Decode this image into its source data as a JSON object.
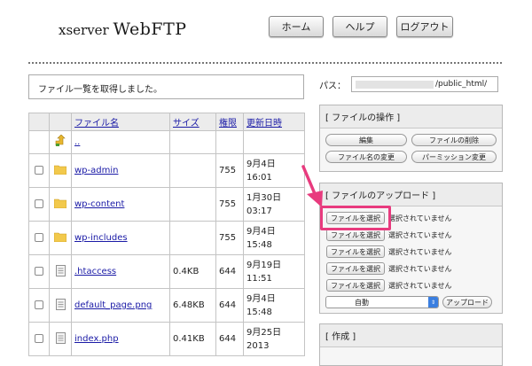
{
  "header": {
    "logo_prefix": "xserver ",
    "logo_main": "WebFTP",
    "buttons": {
      "home": "ホーム",
      "help": "ヘルプ",
      "logout": "ログアウト"
    }
  },
  "status_message": "ファイル一覧を取得しました。",
  "path": {
    "label": "パス：",
    "value": "/public_html/"
  },
  "file_table": {
    "columns": [
      "ファイル名",
      "サイズ",
      "権限",
      "更新日時"
    ],
    "parent_link": "..",
    "rows": [
      {
        "name": "wp-admin",
        "size": "",
        "perm": "755",
        "date": "9月4日",
        "time": "16:01",
        "icon": "folder-icon"
      },
      {
        "name": "wp-content",
        "size": "",
        "perm": "755",
        "date": "1月30日",
        "time": "03:17",
        "icon": "folder-icon"
      },
      {
        "name": "wp-includes",
        "size": "",
        "perm": "755",
        "date": "9月4日",
        "time": "15:48",
        "icon": "folder-icon"
      },
      {
        "name": ".htaccess",
        "size": "0.4KB",
        "perm": "644",
        "date": "9月19日",
        "time": "11:51",
        "icon": "file-icon"
      },
      {
        "name": "default_page.png",
        "size": "6.48KB",
        "perm": "644",
        "date": "9月4日",
        "time": "15:48",
        "icon": "file-icon"
      },
      {
        "name": "index.php",
        "size": "0.41KB",
        "perm": "644",
        "date": "9月25日",
        "time": "2013",
        "icon": "file-icon"
      }
    ]
  },
  "file_ops": {
    "title": "[ ファイルの操作 ]",
    "edit": "編集",
    "delete": "ファイルの削除",
    "rename": "ファイル名の変更",
    "permission": "パーミッション変更"
  },
  "upload": {
    "title": "[ ファイルのアップロード ]",
    "choose_label": "ファイルを選択",
    "no_file_label": "選択されていません",
    "mode_value": "自動",
    "upload_button": "アップロード"
  },
  "create": {
    "title": "[ 作成 ]"
  },
  "colors": {
    "highlight": "#e83b7e",
    "link": "#1a1aa6",
    "select_arrow": "#3b7fe0"
  }
}
